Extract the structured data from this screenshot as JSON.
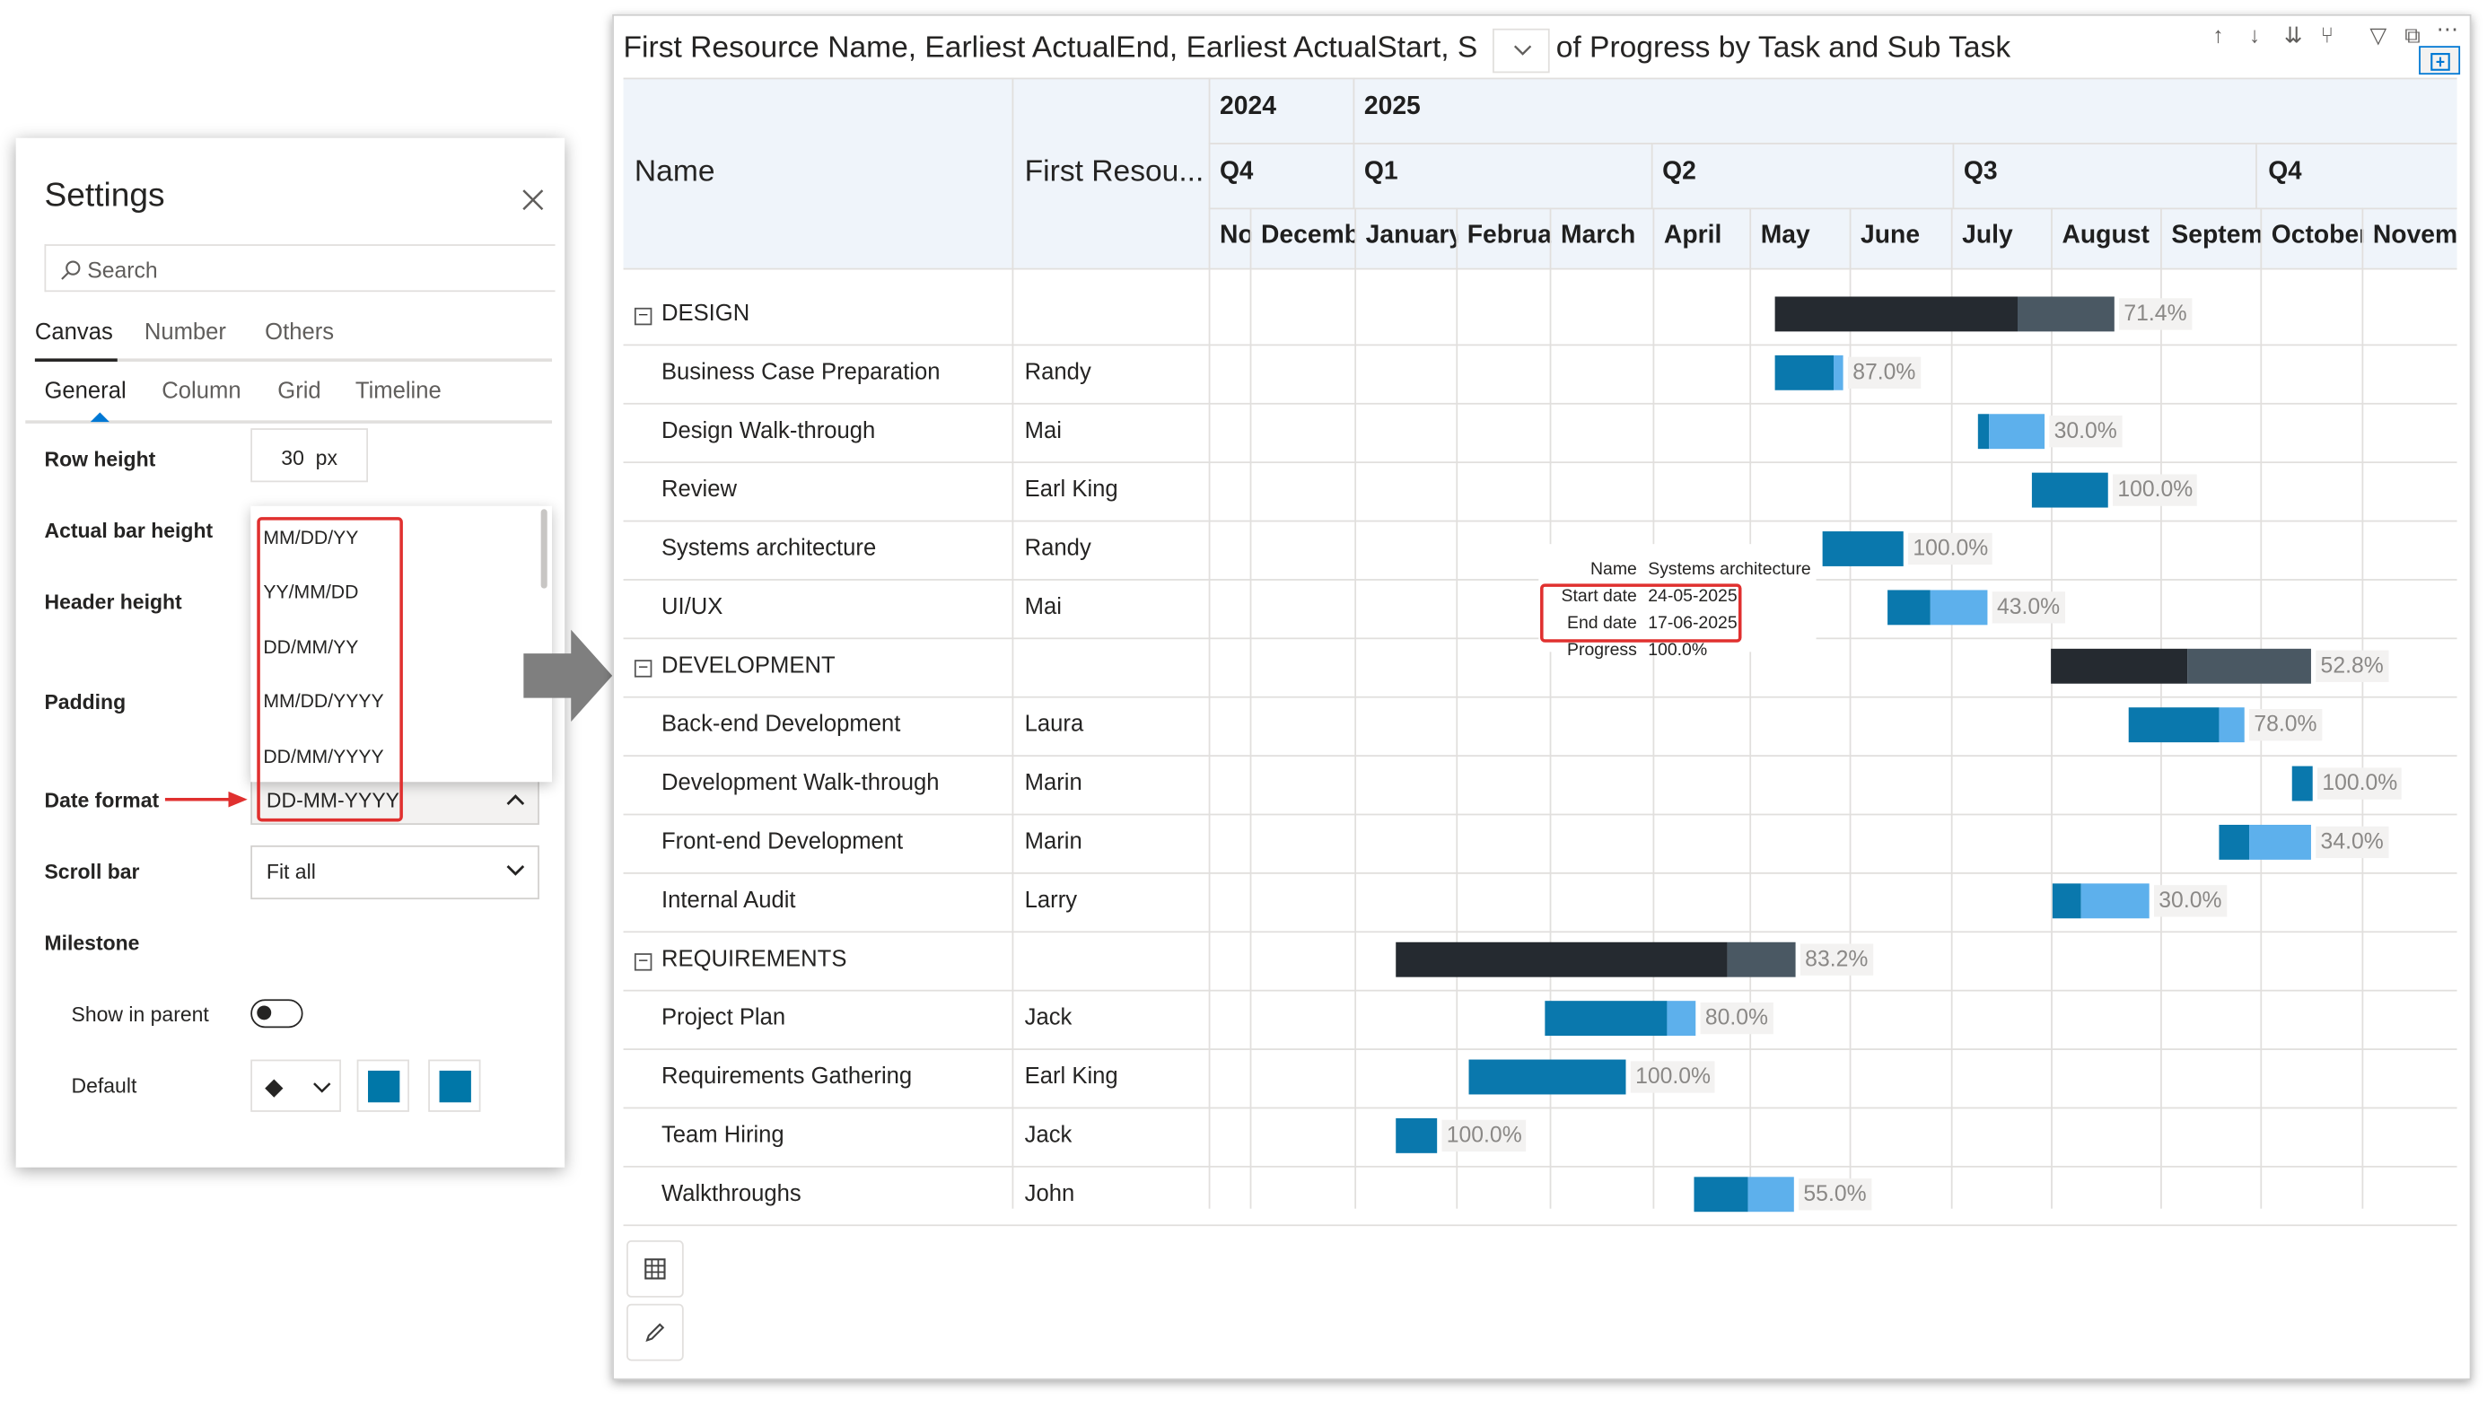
{
  "settings": {
    "title": "Settings",
    "search_placeholder": "Search",
    "tabs": [
      "Canvas",
      "Number",
      "Others"
    ],
    "subtabs": [
      "General",
      "Column",
      "Grid",
      "Timeline"
    ],
    "row_height": {
      "label": "Row height",
      "value": "30",
      "unit": "px"
    },
    "actual_bar_height": {
      "label": "Actual bar height"
    },
    "header_height": {
      "label": "Header height"
    },
    "padding": {
      "label": "Padding"
    },
    "date_format": {
      "label": "Date format",
      "value": "DD-MM-YYYY",
      "options": [
        "MM/DD/YY",
        "YY/MM/DD",
        "DD/MM/YY",
        "MM/DD/YYYY",
        "DD/MM/YYYY"
      ]
    },
    "scroll_bar": {
      "label": "Scroll bar",
      "value": "Fit all"
    },
    "milestone": {
      "label": "Milestone",
      "show_in_parent": "Show in parent",
      "default": "Default",
      "shape": "◆"
    },
    "swatch_color": "#0077a8"
  },
  "visual": {
    "title_left": "First Resource Name, Earliest ActualEnd, Earliest ActualStart, S",
    "title_right": "of Progress by Task and Sub Task",
    "col_name": "Name",
    "col_resource": "First Resou...",
    "years": [
      "2024",
      "2025"
    ],
    "quarters": [
      "Q4",
      "Q1",
      "Q2",
      "Q3",
      "Q4"
    ],
    "months": [
      "No",
      "Decemb",
      "January",
      "Februa",
      "March",
      "April",
      "May",
      "June",
      "July",
      "August",
      "Septem",
      "October",
      "Novemb"
    ],
    "rows": [
      {
        "name": "DESIGN",
        "resource": "",
        "progress": "71.4%",
        "group": true
      },
      {
        "name": "Business Case Preparation",
        "resource": "Randy",
        "progress": "87.0%"
      },
      {
        "name": "Design Walk-through",
        "resource": "Mai",
        "progress": "30.0%"
      },
      {
        "name": "Review",
        "resource": "Earl King",
        "progress": "100.0%"
      },
      {
        "name": "Systems architecture",
        "resource": "Randy",
        "progress": "100.0%"
      },
      {
        "name": "UI/UX",
        "resource": "Mai",
        "progress": "43.0%"
      },
      {
        "name": "DEVELOPMENT",
        "resource": "",
        "progress": "52.8%",
        "group": true
      },
      {
        "name": "Back-end Development",
        "resource": "Laura",
        "progress": "78.0%"
      },
      {
        "name": "Development Walk-through",
        "resource": "Marin",
        "progress": "100.0%"
      },
      {
        "name": "Front-end Development",
        "resource": "Marin",
        "progress": "34.0%"
      },
      {
        "name": "Internal Audit",
        "resource": "Larry",
        "progress": "30.0%"
      },
      {
        "name": "REQUIREMENTS",
        "resource": "",
        "progress": "83.2%",
        "group": true
      },
      {
        "name": "Project Plan",
        "resource": "Jack",
        "progress": "80.0%"
      },
      {
        "name": "Requirements Gathering",
        "resource": "Earl King",
        "progress": "100.0%"
      },
      {
        "name": "Team Hiring",
        "resource": " Jack",
        "progress": "100.0%"
      },
      {
        "name": "Walkthroughs",
        "resource": "John",
        "progress": "55.0%"
      }
    ],
    "tooltip": {
      "name_label": "Name",
      "name_value": "Systems architecture",
      "start_label": "Start date",
      "start_value": "24-05-2025",
      "end_label": "End date",
      "end_value": "17-06-2025",
      "progress_label": "Progress",
      "progress_value": "100.0%"
    },
    "colors": {
      "group_done": "#252a30",
      "group_remaining": "#4a5863",
      "task_done": "#0a78ad",
      "task_remaining": "#5db0ec",
      "header_bg": "#eff4fa"
    }
  }
}
